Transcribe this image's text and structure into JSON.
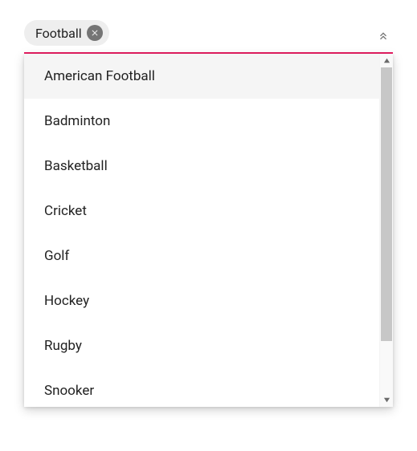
{
  "chip": {
    "label": "Football"
  },
  "dropdown": {
    "options": [
      {
        "label": "American Football",
        "highlighted": true
      },
      {
        "label": "Badminton",
        "highlighted": false
      },
      {
        "label": "Basketball",
        "highlighted": false
      },
      {
        "label": "Cricket",
        "highlighted": false
      },
      {
        "label": "Golf",
        "highlighted": false
      },
      {
        "label": "Hockey",
        "highlighted": false
      },
      {
        "label": "Rugby",
        "highlighted": false
      },
      {
        "label": "Snooker",
        "highlighted": false
      }
    ]
  }
}
